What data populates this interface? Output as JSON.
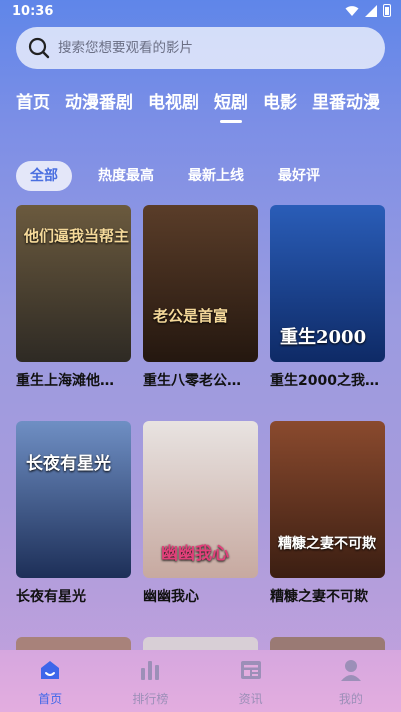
{
  "status_bar": {
    "time": "10:36"
  },
  "search": {
    "placeholder": "搜索您想要观看的影片"
  },
  "tabs": [
    {
      "label": "首页"
    },
    {
      "label": "动漫番剧"
    },
    {
      "label": "电视剧"
    },
    {
      "label": "短剧"
    },
    {
      "label": "电影"
    },
    {
      "label": "里番动漫"
    }
  ],
  "active_tab": "短剧",
  "filters": [
    {
      "label": "全部"
    },
    {
      "label": "热度最高"
    },
    {
      "label": "最新上线"
    },
    {
      "label": "最好评"
    }
  ],
  "active_filter": "全部",
  "cards": [
    {
      "title": "重生上海滩他…",
      "poster_text": "他们逼我当帮主",
      "poster_colors": [
        "#6b5a3e",
        "#2e2a24"
      ]
    },
    {
      "title": "重生八零老公…",
      "poster_text": "老公是首富",
      "poster_colors": [
        "#5a3d29",
        "#24170f"
      ]
    },
    {
      "title": "重生2000之我…",
      "poster_text": "重生2000",
      "poster_colors": [
        "#2a5db8",
        "#0e2a66"
      ]
    },
    {
      "title": "长夜有星光",
      "poster_text": "长夜有星光",
      "poster_colors": [
        "#6f8fc4",
        "#1d2f58"
      ]
    },
    {
      "title": "幽幽我心",
      "poster_text": "幽幽我心",
      "poster_colors": [
        "#e8e3e1",
        "#c7a9a0"
      ]
    },
    {
      "title": "糟糠之妻不可欺",
      "poster_text": "糟糠之妻不可欺",
      "poster_colors": [
        "#8a4a2e",
        "#3b1e12"
      ]
    }
  ],
  "nav": [
    {
      "label": "首页",
      "icon": "home-icon",
      "active": true
    },
    {
      "label": "排行榜",
      "icon": "ranking-icon",
      "active": false
    },
    {
      "label": "资讯",
      "icon": "news-icon",
      "active": false
    },
    {
      "label": "我的",
      "icon": "profile-icon",
      "active": false
    }
  ],
  "colors": {
    "accent": "#3d66ea",
    "nav_inactive": "#9c8fb8"
  }
}
